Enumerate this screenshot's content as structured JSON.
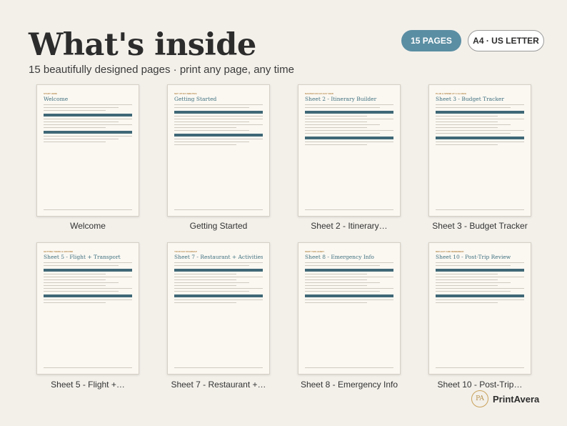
{
  "header": {
    "title": "What's inside",
    "subtitle": "15 beautifully designed pages · print any page, any time",
    "badge_pages": "15 PAGES",
    "badge_size": "A4 · US LETTER"
  },
  "pages": [
    {
      "caption": "Welcome",
      "kicker": "START HERE",
      "title": "Welcome"
    },
    {
      "caption": "Getting Started",
      "kicker": "SET UP IN 5 MINUTES",
      "title": "Getting Started"
    },
    {
      "caption": "Sheet 2 - Itinerary…",
      "kicker": "MASTER DAY-BY-DAY VIEW",
      "title": "Sheet 2 - Itinerary Builder"
    },
    {
      "caption": "Sheet 3 - Budget Tracker",
      "kicker": "PLAN & SPEND AT A GLANCE",
      "title": "Sheet 3 - Budget Tracker"
    },
    {
      "caption": "Sheet 5 - Flight +…",
      "kicker": "GETTING THERE & AROUND",
      "title": "Sheet 5 - Flight + Transport"
    },
    {
      "caption": "Sheet 7 - Restaurant +…",
      "kicker": "YOUR DAY ROADMAP",
      "title": "Sheet 7 - Restaurant + Activities"
    },
    {
      "caption": "Sheet 8 - Emergency Info",
      "kicker": "KEEP THIS HANDY",
      "title": "Sheet 8 - Emergency Info"
    },
    {
      "caption": "Sheet 10 - Post-Trip…",
      "kicker": "REFLECT AND REMEMBER",
      "title": "Sheet 10 - Post-Trip Review"
    }
  ],
  "brand": {
    "logo": "PA",
    "name": "PrintAvera"
  },
  "colors": {
    "accent": "#5a8ea3",
    "section_bar": "#3f6876",
    "heading": "#3e6f7e",
    "background": "#f3f0ea"
  }
}
